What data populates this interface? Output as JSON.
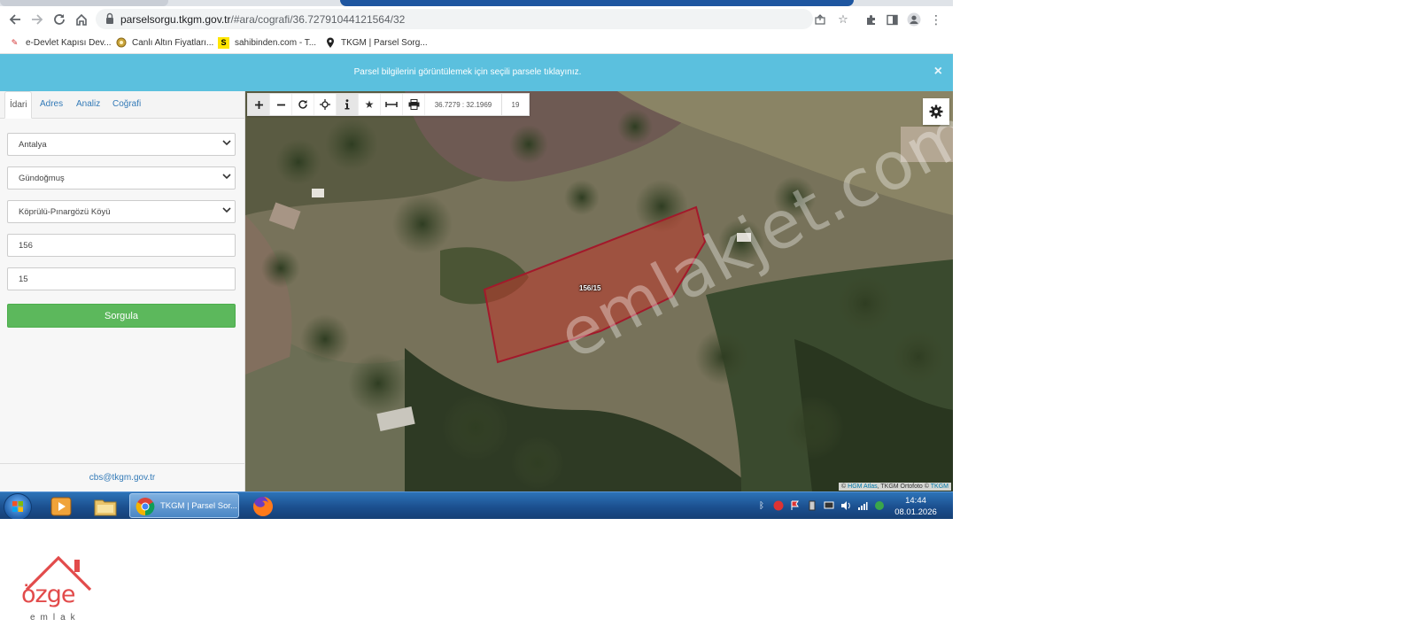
{
  "browser": {
    "url_host": "parselsorgu.tkgm.gov.tr",
    "url_path": "/#ara/cografi/36.72791044121564/32"
  },
  "bookmarks": [
    {
      "label": "e-Devlet Kapısı Dev..."
    },
    {
      "label": "Canlı Altın Fiyatları..."
    },
    {
      "label": "sahibinden.com - T..."
    },
    {
      "label": "TKGM | Parsel Sorg..."
    }
  ],
  "notice": {
    "message": "Parsel bilgilerini görüntülemek için seçili parsele tıklayınız.",
    "close": "×"
  },
  "sidebar": {
    "tabs": [
      {
        "label": "İdari",
        "active": true
      },
      {
        "label": "Adres"
      },
      {
        "label": "Analiz"
      },
      {
        "label": "Coğrafi"
      }
    ],
    "fields": {
      "province": "Antalya",
      "district": "Gündoğmuş",
      "neighborhood": "Köprülü-Pınargözü Köyü",
      "block": "156",
      "parcel": "15"
    },
    "submit_label": "Sorgula",
    "footer_email": "cbs@tkgm.gov.tr"
  },
  "map": {
    "coordinates": "36.7279 : 32.1969",
    "zoom": "19",
    "parcel_label": "156/15",
    "attribution_prefix": "©",
    "attribution_link1": "HGM Atlas",
    "attribution_mid": ", TKGM Ortofoto ©",
    "attribution_link2": "TKGM",
    "watermark": "emlakjet.com",
    "parcel_fill": "#c0392b",
    "parcel_stroke": "#a3192b"
  },
  "taskbar": {
    "active_task": "TKGM | Parsel Sor...",
    "time": "14:44",
    "date": "08.01.2026"
  },
  "logo": {
    "name": "özge",
    "sub": "emlak"
  }
}
